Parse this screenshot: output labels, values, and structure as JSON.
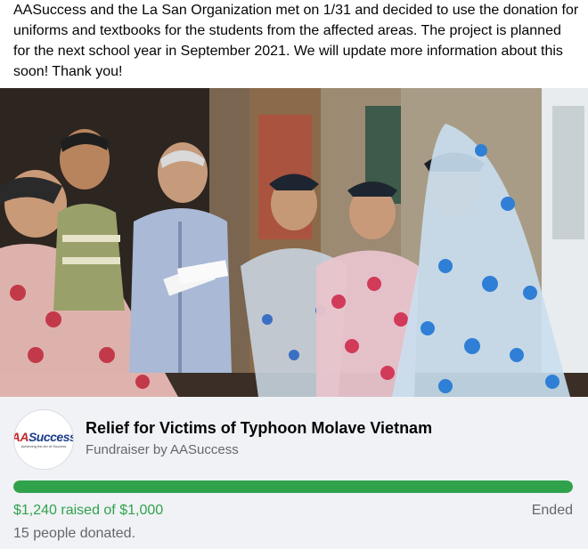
{
  "post": {
    "text": "AASuccess and the La San Organization met on 1/31 and decided to use the donation for uniforms and textbooks for the students from the affected areas. The project is planned for the next school year in September 2021. We will update more information about this soon! Thank you!"
  },
  "photo": {
    "description_icon": "group-photo"
  },
  "fundraiser": {
    "logo_word_prefix": "AA",
    "logo_word_suffix": "Success",
    "logo_tagline": "Achieving the Art of Success",
    "title": "Relief for Victims of Typhoon Molave Vietnam",
    "subtitle": "Fundraiser by AASuccess",
    "progress_fraction": 1.0,
    "raised_text": "$1,240 raised of $1,000",
    "status": "Ended",
    "donors_text": "15 people donated."
  },
  "colors": {
    "progress": "#31a24c",
    "card_bg": "#f0f2f5",
    "secondary_text": "#65676b"
  }
}
